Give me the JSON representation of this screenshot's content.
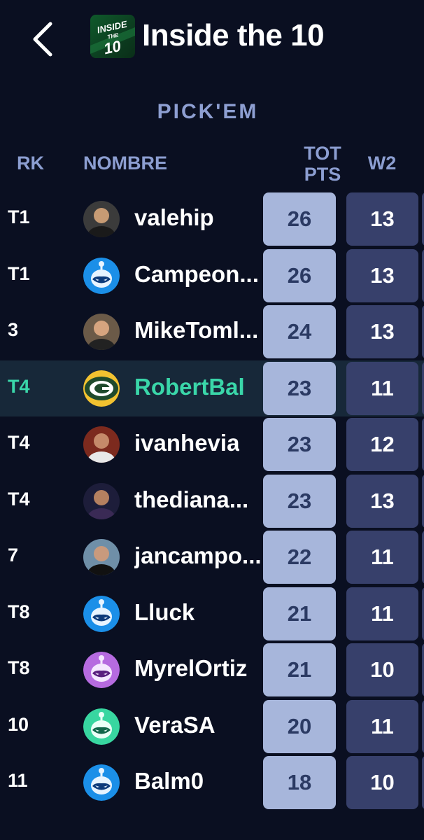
{
  "header": {
    "title": "Inside the 10",
    "logo_text": [
      "INSIDE",
      "THE",
      "10"
    ],
    "back_icon": "chevron-left-icon"
  },
  "section": {
    "title": "PICK'EM"
  },
  "columns": {
    "rank": "RK",
    "name": "NOMBRE",
    "total_line1": "TOT",
    "total_line2": "PTS",
    "week": "W2"
  },
  "colors": {
    "background": "#0a0f21",
    "header_text": "#8c9ed1",
    "highlight_text": "#3ad6a9",
    "highlight_row": "#172839",
    "total_cell": "#a7b6db",
    "week_cell": "#37406b"
  },
  "rows": [
    {
      "rank": "T1",
      "name": "valehip",
      "total": "26",
      "week": "13",
      "avatar": "photo-avatar",
      "current": false
    },
    {
      "rank": "T1",
      "name": "Campeon...",
      "total": "26",
      "week": "13",
      "avatar": "blue-robot-avatar",
      "current": false
    },
    {
      "rank": "3",
      "name": "MikeToml...",
      "total": "24",
      "week": "13",
      "avatar": "photo-avatar",
      "current": false
    },
    {
      "rank": "T4",
      "name": "RobertBal",
      "total": "23",
      "week": "11",
      "avatar": "packers-logo-avatar",
      "current": true
    },
    {
      "rank": "T4",
      "name": "ivanhevia",
      "total": "23",
      "week": "12",
      "avatar": "photo-avatar",
      "current": false
    },
    {
      "rank": "T4",
      "name": "thediana...",
      "total": "23",
      "week": "13",
      "avatar": "photo-avatar",
      "current": false
    },
    {
      "rank": "7",
      "name": "jancampo...",
      "total": "22",
      "week": "11",
      "avatar": "photo-avatar",
      "current": false
    },
    {
      "rank": "T8",
      "name": "Lluck",
      "total": "21",
      "week": "11",
      "avatar": "blue-robot-avatar",
      "current": false
    },
    {
      "rank": "T8",
      "name": "MyrelOrtiz",
      "total": "21",
      "week": "10",
      "avatar": "purple-robot-avatar",
      "current": false
    },
    {
      "rank": "10",
      "name": "VeraSA",
      "total": "20",
      "week": "11",
      "avatar": "green-robot-avatar",
      "current": false
    },
    {
      "rank": "11",
      "name": "Balm0",
      "total": "18",
      "week": "10",
      "avatar": "blue-robot-avatar",
      "current": false
    }
  ]
}
